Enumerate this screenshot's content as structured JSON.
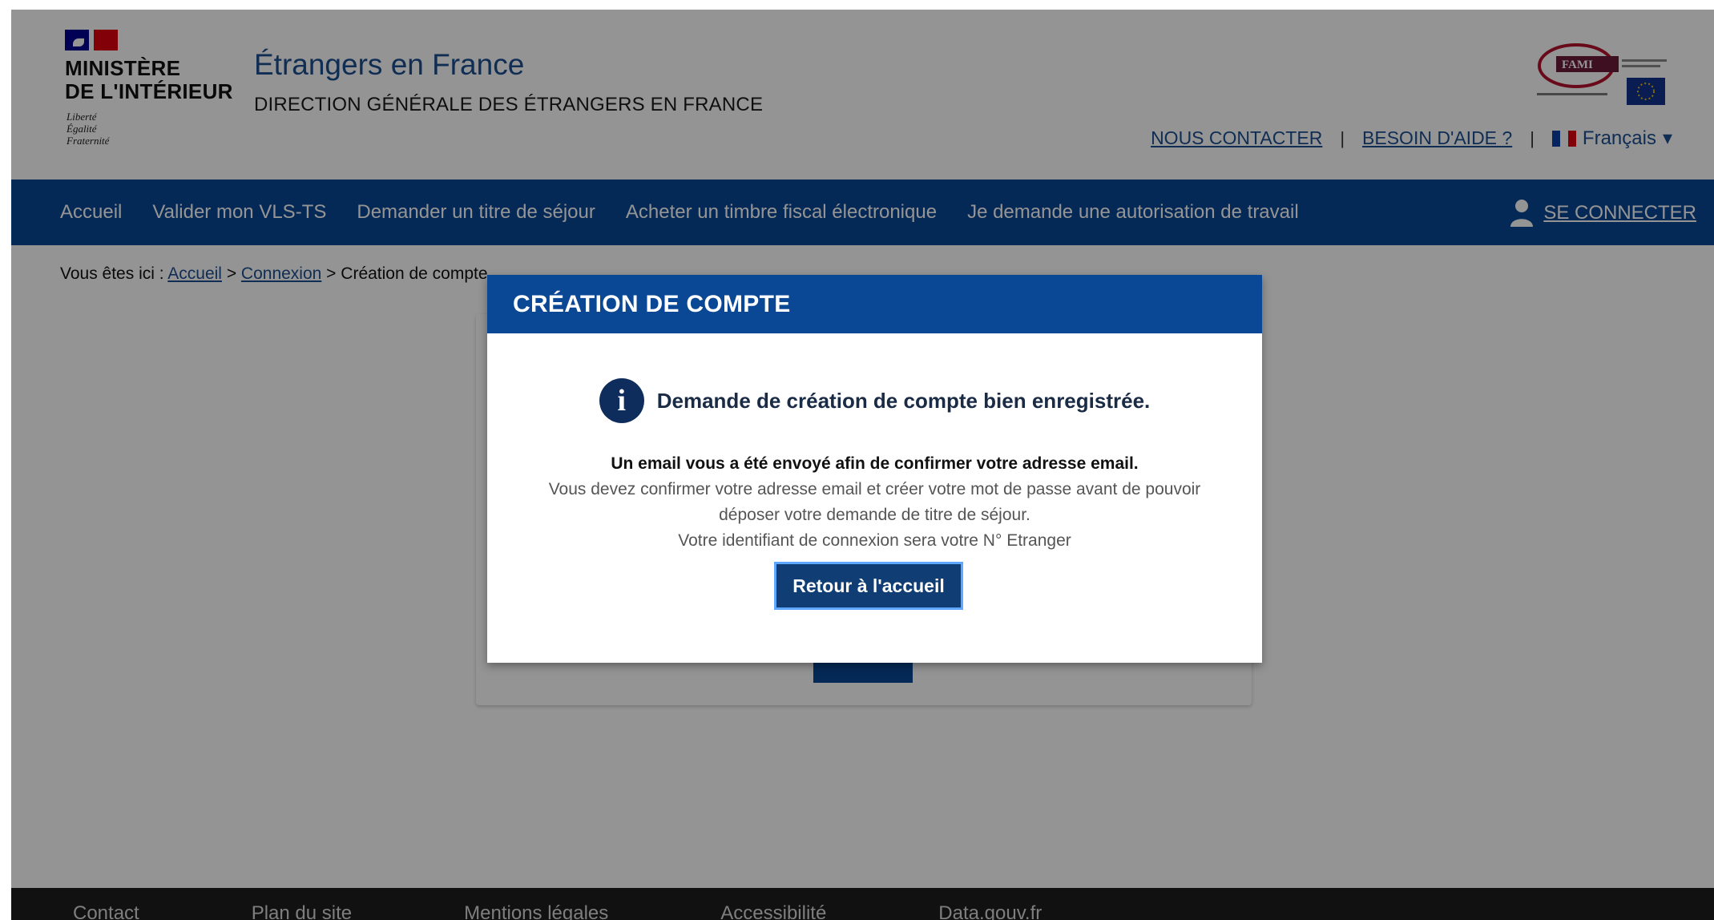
{
  "header": {
    "ministry_line1": "MINISTÈRE",
    "ministry_line2": "DE L'INTÉRIEUR",
    "motto": [
      "Liberté",
      "Égalité",
      "Fraternité"
    ],
    "site_title": "Étrangers en France",
    "site_subtitle": "DIRECTION GÉNÉRALE DES ÉTRANGERS EN FRANCE",
    "fami_logo": "FAMI",
    "top_links": {
      "contact": "NOUS CONTACTER",
      "help": "BESOIN D'AIDE ?",
      "separator": "|",
      "language": "Français"
    }
  },
  "nav": {
    "items": [
      "Accueil",
      "Valider mon VLS-TS",
      "Demander un titre de séjour",
      "Acheter un timbre fiscal électronique",
      "Je demande une autorisation de travail"
    ],
    "login": "SE CONNECTER"
  },
  "breadcrumb": {
    "prefix": "Vous êtes ici :",
    "home": "Accueil",
    "sep": ">",
    "connexion": "Connexion",
    "current": "Création de compte"
  },
  "modal": {
    "title": "CRÉATION DE COMPTE",
    "headline": "Demande de création de compte bien enregistrée.",
    "message_bold": "Un email vous a été envoyé afin de confirmer votre adresse email.",
    "message_line2": "Vous devez confirmer votre adresse email et créer votre mot de passe avant de pouvoir déposer votre demande de titre de séjour.",
    "message_line3": "Votre identifiant de connexion sera votre N° Etranger",
    "button": "Retour à l'accueil"
  },
  "footer": {
    "links": [
      "Contact",
      "Plan du site",
      "Mentions légales",
      "Accessibilité",
      "Data.gouv.fr"
    ]
  },
  "colors": {
    "nav_blue": "#0a4794",
    "modal_button": "#0f3d74",
    "overlay": "rgba(0,0,0,0.42)"
  },
  "icons": {
    "user": "user-icon",
    "info": "info-icon",
    "caret": "caret-down-icon"
  }
}
